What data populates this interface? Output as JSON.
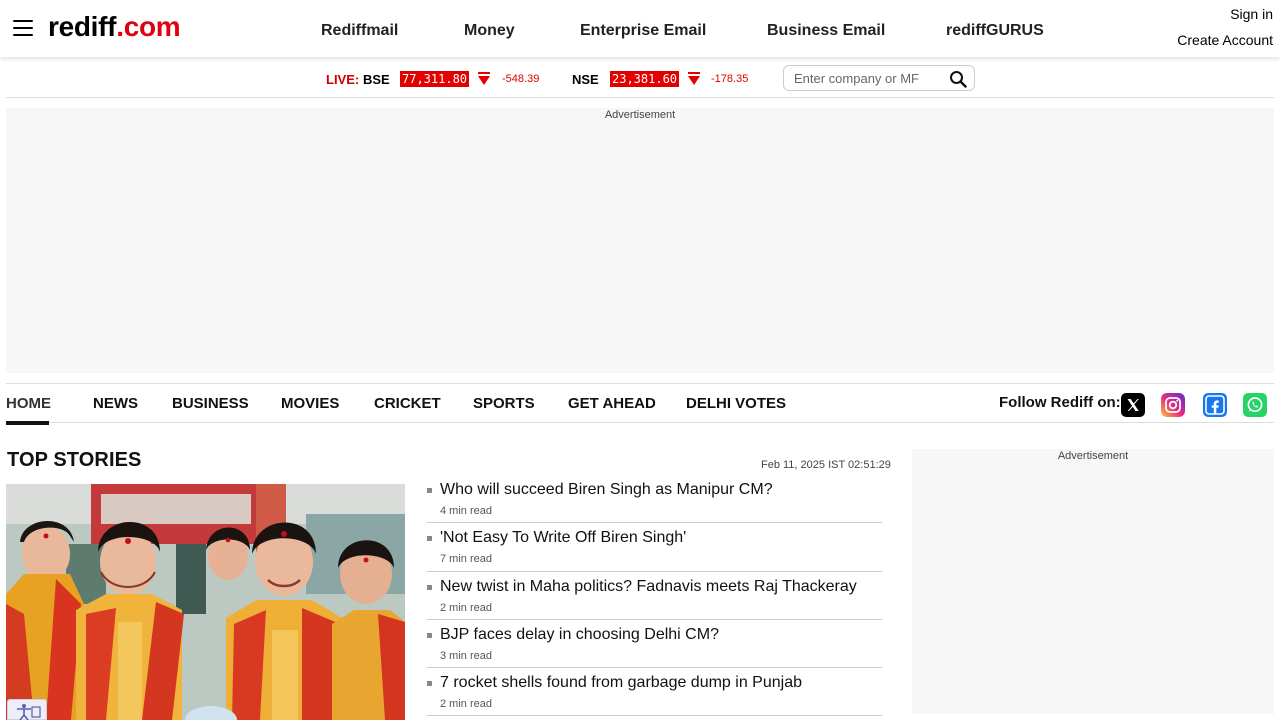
{
  "header": {
    "logo_text_main": "rediff",
    "logo_text_dot": ".",
    "logo_text_com": "com",
    "nav": [
      {
        "label": "Rediffmail"
      },
      {
        "label": "Money"
      },
      {
        "label": "Enterprise Email"
      },
      {
        "label": "Business Email"
      },
      {
        "label": "rediffGURUS"
      }
    ],
    "sign_in": "Sign in",
    "create_account": "Create Account",
    "menu_icon": "hamburger-menu-icon"
  },
  "ticker": {
    "live_label": "LIVE:",
    "bse": {
      "name": "BSE",
      "value": "77,311.80",
      "change": "-548.39",
      "direction": "down"
    },
    "nse": {
      "name": "NSE",
      "value": "23,381.60",
      "change": "-178.35",
      "direction": "down"
    },
    "search_placeholder": "Enter company or MF",
    "search_icon": "search-icon",
    "down_color": "#e30000"
  },
  "ads": {
    "label": "Advertisement"
  },
  "category_nav": {
    "items": [
      {
        "label": "HOME",
        "active": true
      },
      {
        "label": "NEWS"
      },
      {
        "label": "BUSINESS"
      },
      {
        "label": "MOVIES"
      },
      {
        "label": "CRICKET"
      },
      {
        "label": "SPORTS"
      },
      {
        "label": "GET AHEAD"
      },
      {
        "label": "DELHI VOTES"
      }
    ],
    "follow_label": "Follow Rediff on:",
    "social_icons": [
      "x-icon",
      "instagram-icon",
      "facebook-icon",
      "whatsapp-icon"
    ]
  },
  "top_stories": {
    "title": "TOP STORIES",
    "date": "Feb 11, 2025 IST 02:51:29",
    "items": [
      {
        "headline": "Who will succeed Biren Singh as Manipur CM?",
        "read_time": "4 min read"
      },
      {
        "headline": "'Not Easy To Write Off Biren Singh'",
        "read_time": "7 min read"
      },
      {
        "headline": "New twist in Maha politics? Fadnavis meets Raj Thackeray",
        "read_time": "2 min read"
      },
      {
        "headline": "BJP faces delay in choosing Delhi CM?",
        "read_time": "3 min read"
      },
      {
        "headline": "7 rocket shells found from garbage dump in Punjab",
        "read_time": "2 min read"
      }
    ]
  },
  "colors": {
    "brand_red": "#e1000f",
    "ticker_red": "#e30000"
  }
}
